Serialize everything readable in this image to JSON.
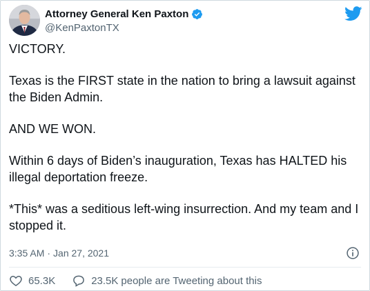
{
  "author": {
    "display_name": "Attorney General Ken Paxton",
    "handle": "@KenPaxtonTX",
    "verified": true
  },
  "tweet": {
    "paragraphs": [
      "VICTORY.",
      "Texas is the FIRST state in the nation to bring a lawsuit against the Biden Admin.",
      "AND WE WON.",
      "Within 6 days of Biden’s inauguration, Texas has HALTED his illegal deportation freeze.",
      "*This* was a seditious left-wing insurrection. And my team and I stopped it."
    ],
    "time": "3:35 AM",
    "separator": "·",
    "date": "Jan 27, 2021"
  },
  "actions": {
    "likes": "65.3K",
    "tweeting_count": "23.5K",
    "tweeting_text": "people are Tweeting about this"
  },
  "colors": {
    "brand": "#1d9bf0",
    "text": "#0f1419",
    "secondary": "#536471"
  },
  "icons": [
    "verified-badge-icon",
    "twitter-bird-icon",
    "info-icon",
    "heart-icon",
    "reply-bubble-icon"
  ]
}
